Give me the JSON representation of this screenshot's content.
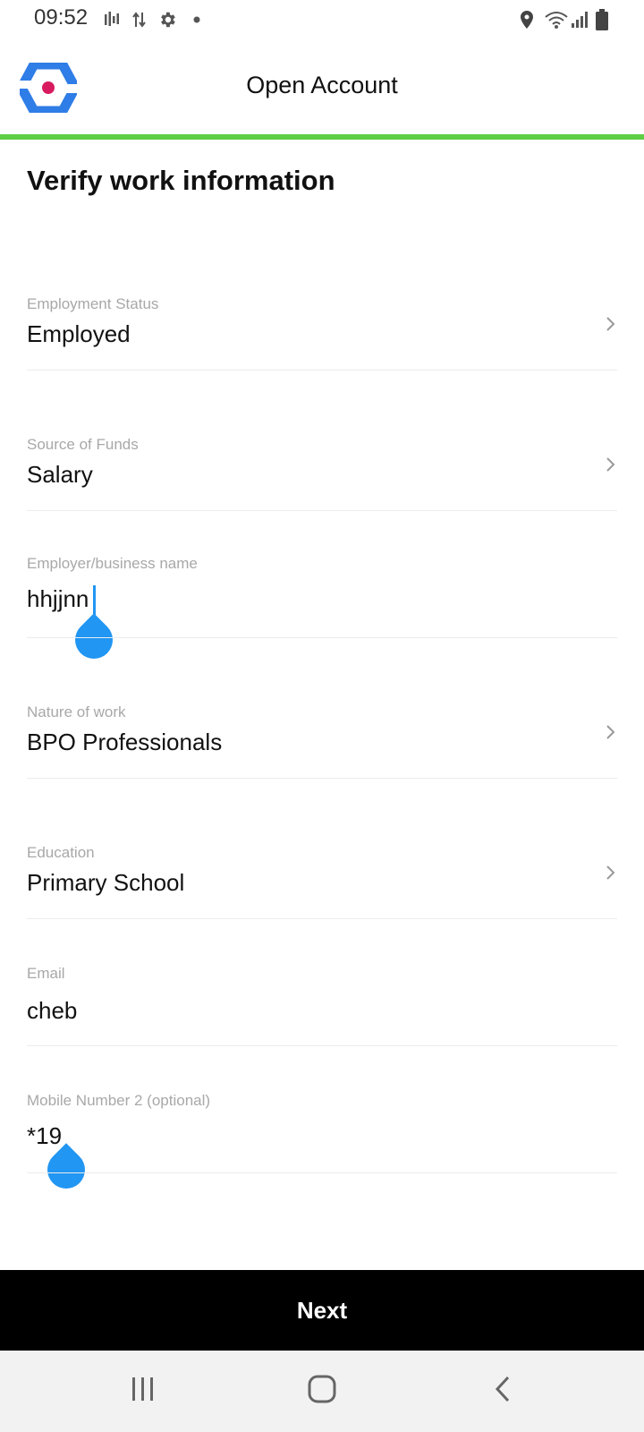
{
  "status_bar": {
    "time": "09:52",
    "left_icons": [
      "signal-activity-icon",
      "data-transfer-icon",
      "settings-gear-icon",
      "notification-dot-icon"
    ],
    "right_icons": [
      "location-icon",
      "wifi-icon",
      "cell-signal-icon",
      "battery-icon"
    ]
  },
  "header": {
    "title": "Open Account",
    "logo_icon": "app-logo-icon",
    "progress_color": "#5fcf45"
  },
  "page_title": "Verify work information",
  "fields": {
    "employment_status": {
      "label": "Employment Status",
      "value": "Employed"
    },
    "source_of_funds": {
      "label": "Source of Funds",
      "value": "Salary"
    },
    "employer_name": {
      "label": "Employer/business name",
      "value": "hhjjnn"
    },
    "nature_of_work": {
      "label": "Nature of work",
      "value": "BPO Professionals"
    },
    "education": {
      "label": "Education",
      "value": "Primary School"
    },
    "email": {
      "label": "Email",
      "value": "cheb"
    },
    "mobile_number_2": {
      "label": "Mobile Number 2 (optional)",
      "value": "*19"
    }
  },
  "next_button": {
    "label": "Next"
  },
  "nav_bar": {
    "icons": [
      "recent-apps-icon",
      "home-icon",
      "back-icon"
    ]
  },
  "colors": {
    "accent": "#2196f3",
    "progress": "#5fcf45",
    "button_bg": "#000000"
  }
}
